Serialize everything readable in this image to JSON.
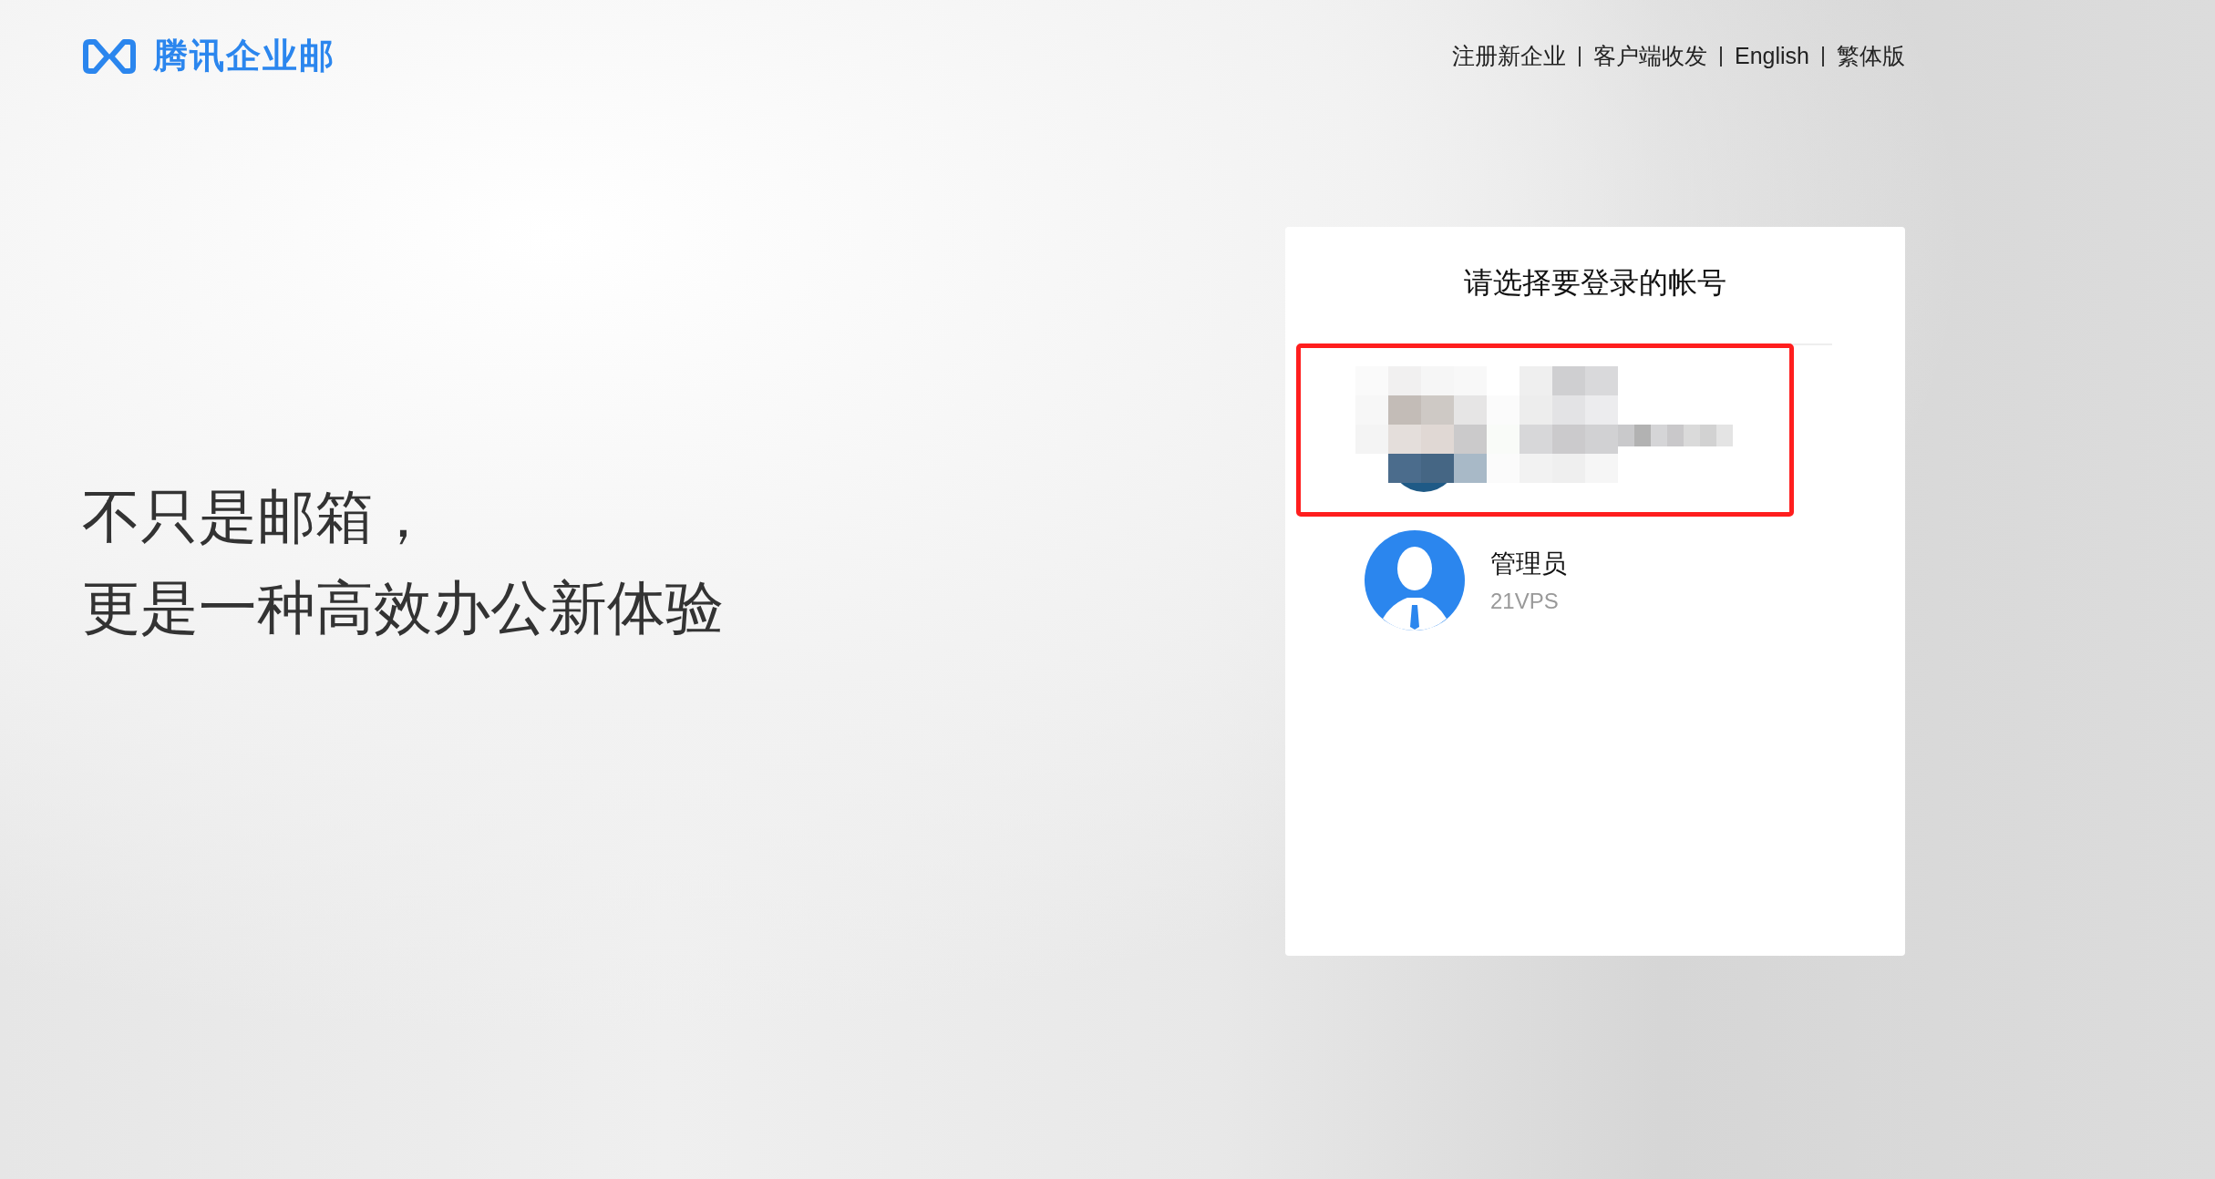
{
  "header": {
    "logo_text": "腾讯企业邮",
    "nav_links": [
      "注册新企业",
      "客户端收发",
      "English",
      "繁体版"
    ]
  },
  "tagline": [
    "不只是邮箱，",
    "更是一种高效办公新体验"
  ],
  "account_picker": {
    "title": "请选择要登录的帐号",
    "accounts": [
      {
        "kind": "pixelated",
        "highlighted": true
      },
      {
        "kind": "plain",
        "highlighted": false,
        "name": "管理员",
        "domain": "21VPS"
      }
    ]
  }
}
